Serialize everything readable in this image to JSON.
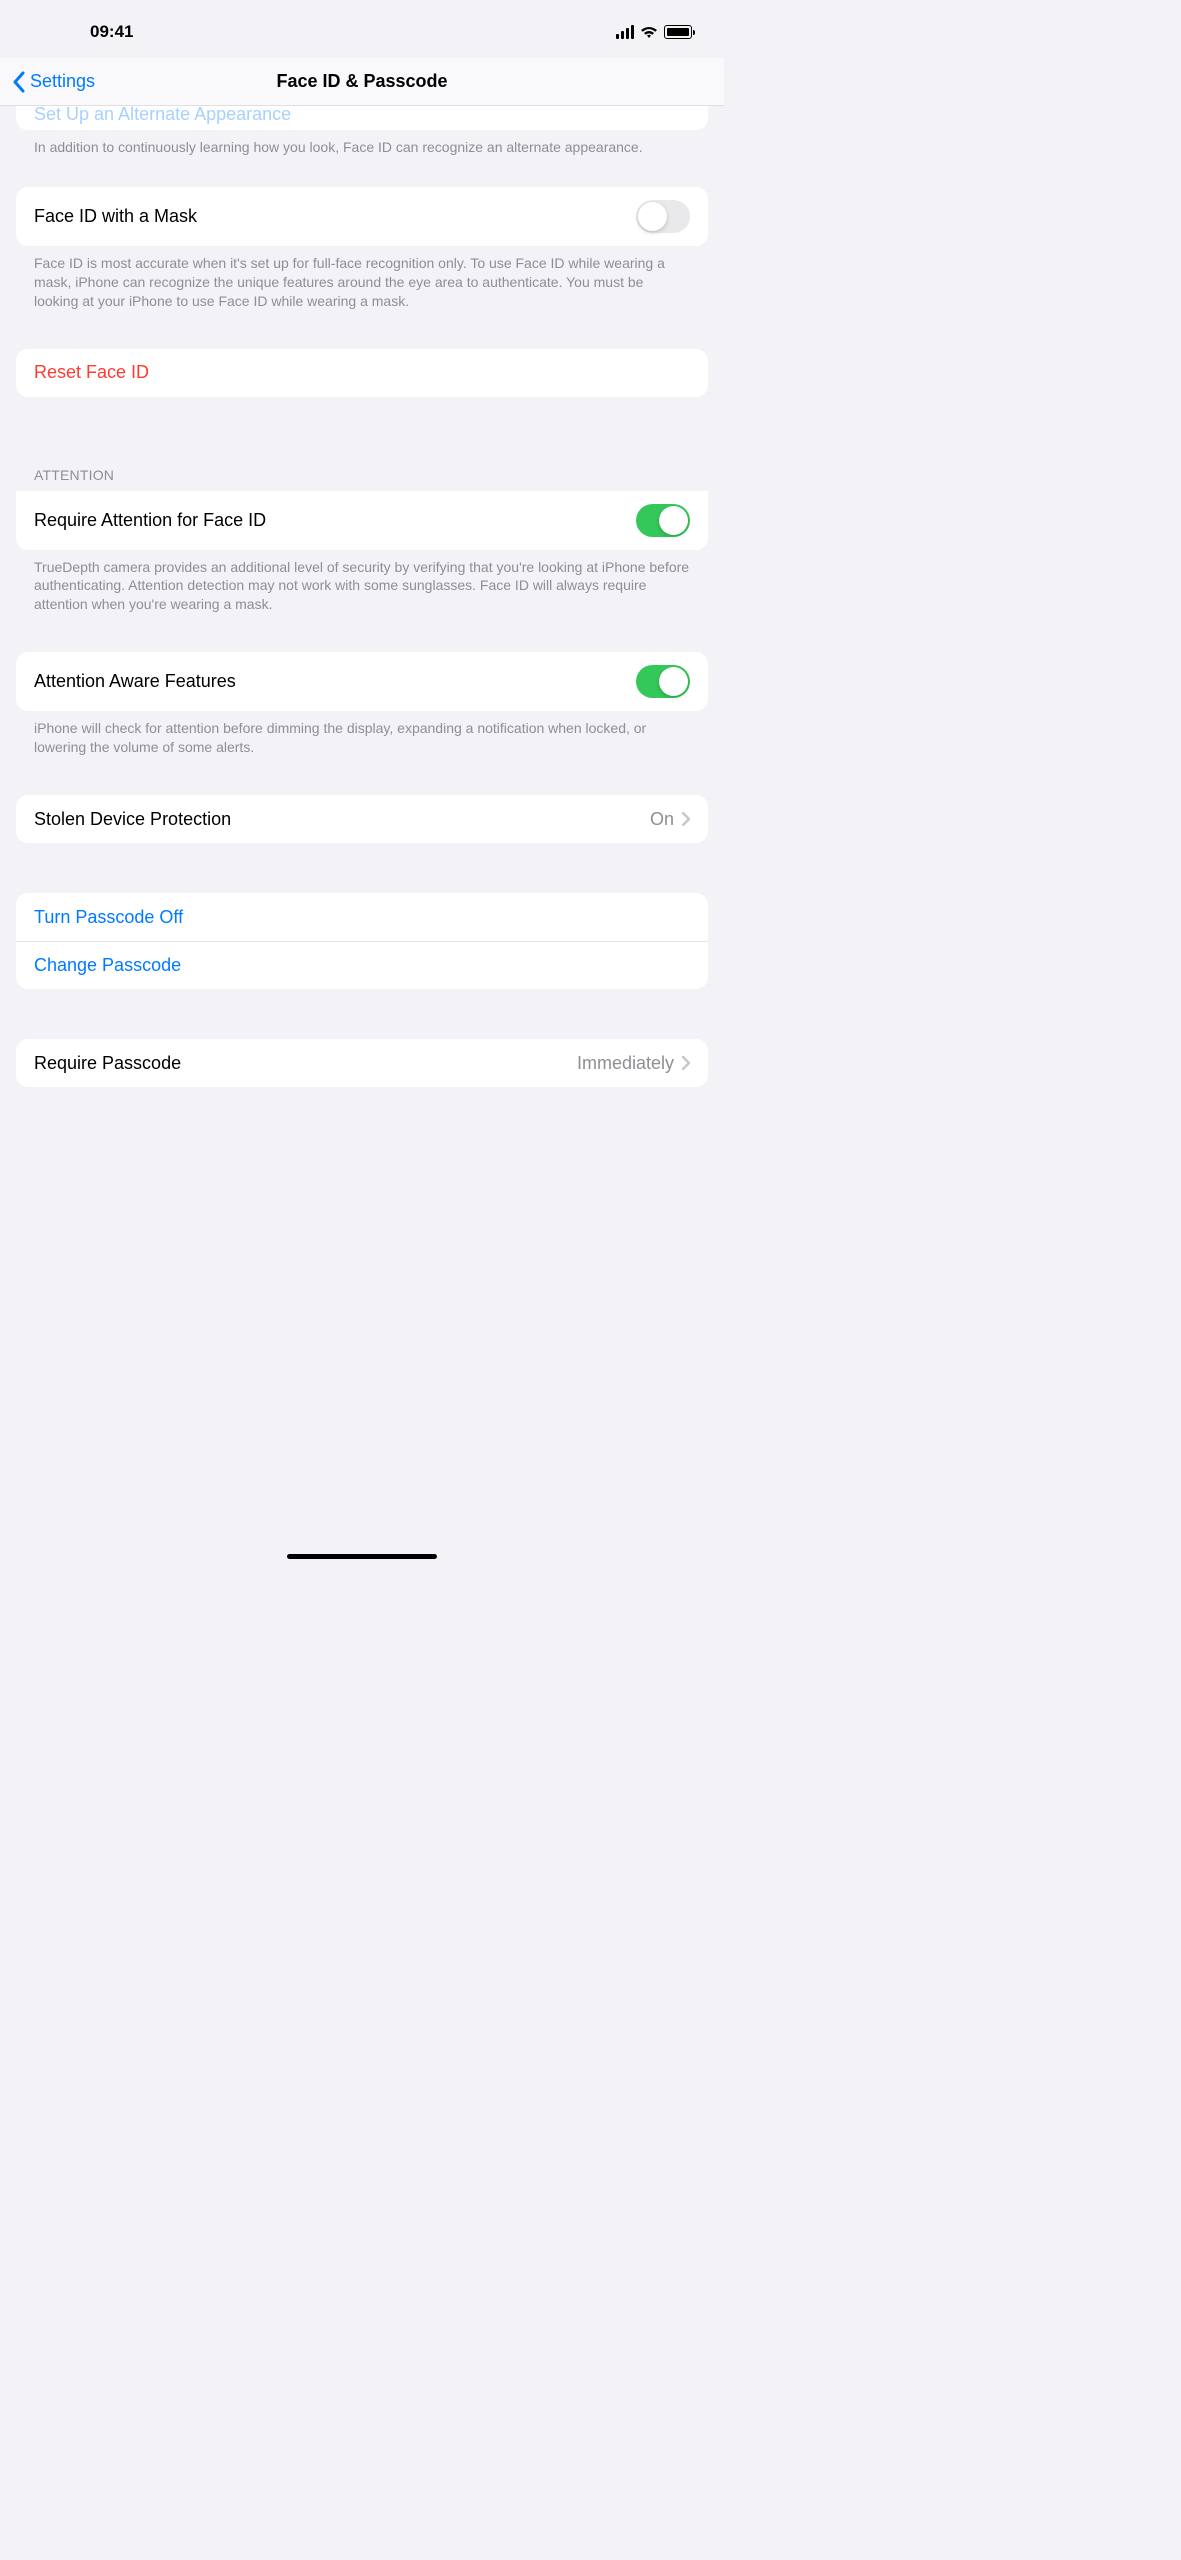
{
  "status": {
    "time": "09:41"
  },
  "nav": {
    "back": "Settings",
    "title": "Face ID & Passcode"
  },
  "alternate": {
    "truncated_label": "Set Up an Alternate Appearance",
    "footer": "In addition to continuously learning how you look, Face ID can recognize an alternate appearance."
  },
  "mask": {
    "label": "Face ID with a Mask",
    "enabled": false,
    "footer": "Face ID is most accurate when it's set up for full-face recognition only. To use Face ID while wearing a mask, iPhone can recognize the unique features around the eye area to authenticate. You must be looking at your iPhone to use Face ID while wearing a mask."
  },
  "reset": {
    "label": "Reset Face ID"
  },
  "attention": {
    "header": "Attention",
    "require": {
      "label": "Require Attention for Face ID",
      "enabled": true,
      "footer": "TrueDepth camera provides an additional level of security by verifying that you're looking at iPhone before authenticating. Attention detection may not work with some sunglasses. Face ID will always require attention when you're wearing a mask."
    },
    "aware": {
      "label": "Attention Aware Features",
      "enabled": true,
      "footer": "iPhone will check for attention before dimming the display, expanding a notification when locked, or lowering the volume of some alerts."
    }
  },
  "stolen": {
    "label": "Stolen Device Protection",
    "value": "On"
  },
  "passcode": {
    "turn_off": "Turn Passcode Off",
    "change": "Change Passcode",
    "require_label": "Require Passcode",
    "require_value": "Immediately"
  }
}
